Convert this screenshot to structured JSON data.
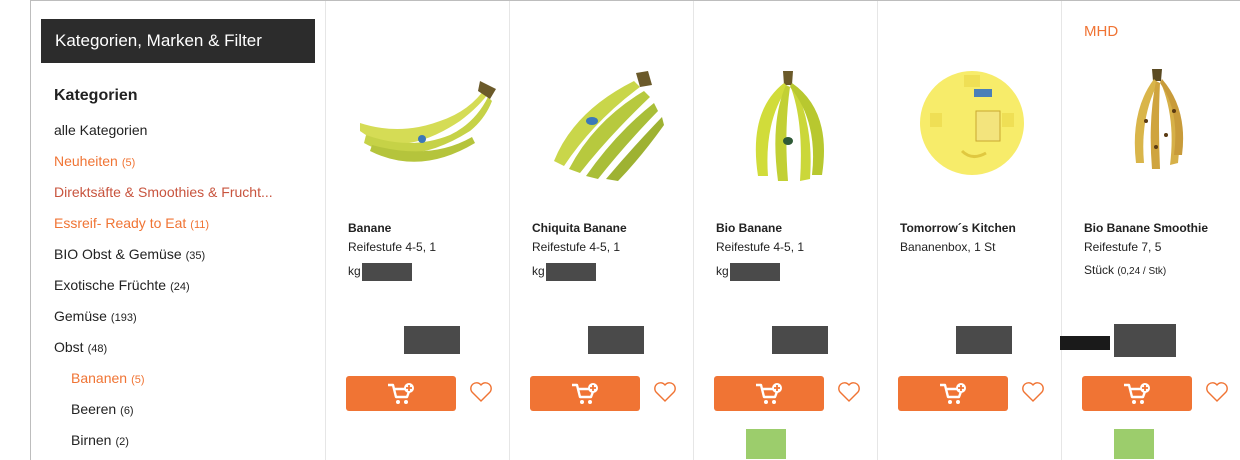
{
  "sidebar": {
    "header": "Kategorien, Marken & Filter",
    "title": "Kategorien",
    "items": [
      {
        "label": "alle Kategorien",
        "count": "",
        "style": "normal"
      },
      {
        "label": "Neuheiten",
        "count": "(5)",
        "style": "orange"
      },
      {
        "label": "Direktsäfte & Smoothies & Frucht...",
        "count": "",
        "style": "brown"
      },
      {
        "label": "Essreif- Ready to Eat",
        "count": "(11)",
        "style": "orange"
      },
      {
        "label": "BIO Obst & Gemüse",
        "count": "(35)",
        "style": "normal"
      },
      {
        "label": "Exotische Früchte",
        "count": "(24)",
        "style": "normal"
      },
      {
        "label": "Gemüse",
        "count": "(193)",
        "style": "normal"
      },
      {
        "label": "Obst",
        "count": "(48)",
        "style": "normal"
      },
      {
        "label": "Bananen",
        "count": "(5)",
        "style": "orange-sub"
      },
      {
        "label": "Beeren",
        "count": "(6)",
        "style": "sub"
      },
      {
        "label": "Birnen",
        "count": "(2)",
        "style": "sub"
      }
    ]
  },
  "products": [
    {
      "badge": "",
      "name": "Banane",
      "line1": "Reifestufe 4-5, 1",
      "line2": "kg",
      "unit_price": "",
      "bio": false,
      "image": "banana-bunch"
    },
    {
      "badge": "",
      "name": "Chiquita Banane",
      "line1": "Reifestufe 4-5, 1",
      "line2": "kg",
      "unit_price": "",
      "bio": false,
      "image": "chiquita-bunch"
    },
    {
      "badge": "",
      "name": "Bio Banane",
      "line1": "Reifestufe 4-5, 1",
      "line2": "kg",
      "unit_price": "",
      "bio": true,
      "image": "bio-bunch"
    },
    {
      "badge": "",
      "name": "Tomorrow´s Kitchen",
      "line1": "Bananenbox, 1 St",
      "line2": "",
      "unit_price": "",
      "bio": false,
      "image": "banana-box"
    },
    {
      "badge": "MHD",
      "name": "Bio Banane Smoothie",
      "line1": "Reifestufe 7, 5",
      "line2": "Stück",
      "unit_price": "(0,24 / Stk)",
      "bio": true,
      "image": "ripe-bunch"
    }
  ],
  "icons": {
    "cart": "add-to-cart-icon",
    "wishlist": "heart-icon"
  },
  "colors": {
    "accent": "#f07434",
    "header_bg": "#2c2c2c",
    "redacted": "#4a4a4a",
    "bio_badge": "#9ccd6c"
  }
}
